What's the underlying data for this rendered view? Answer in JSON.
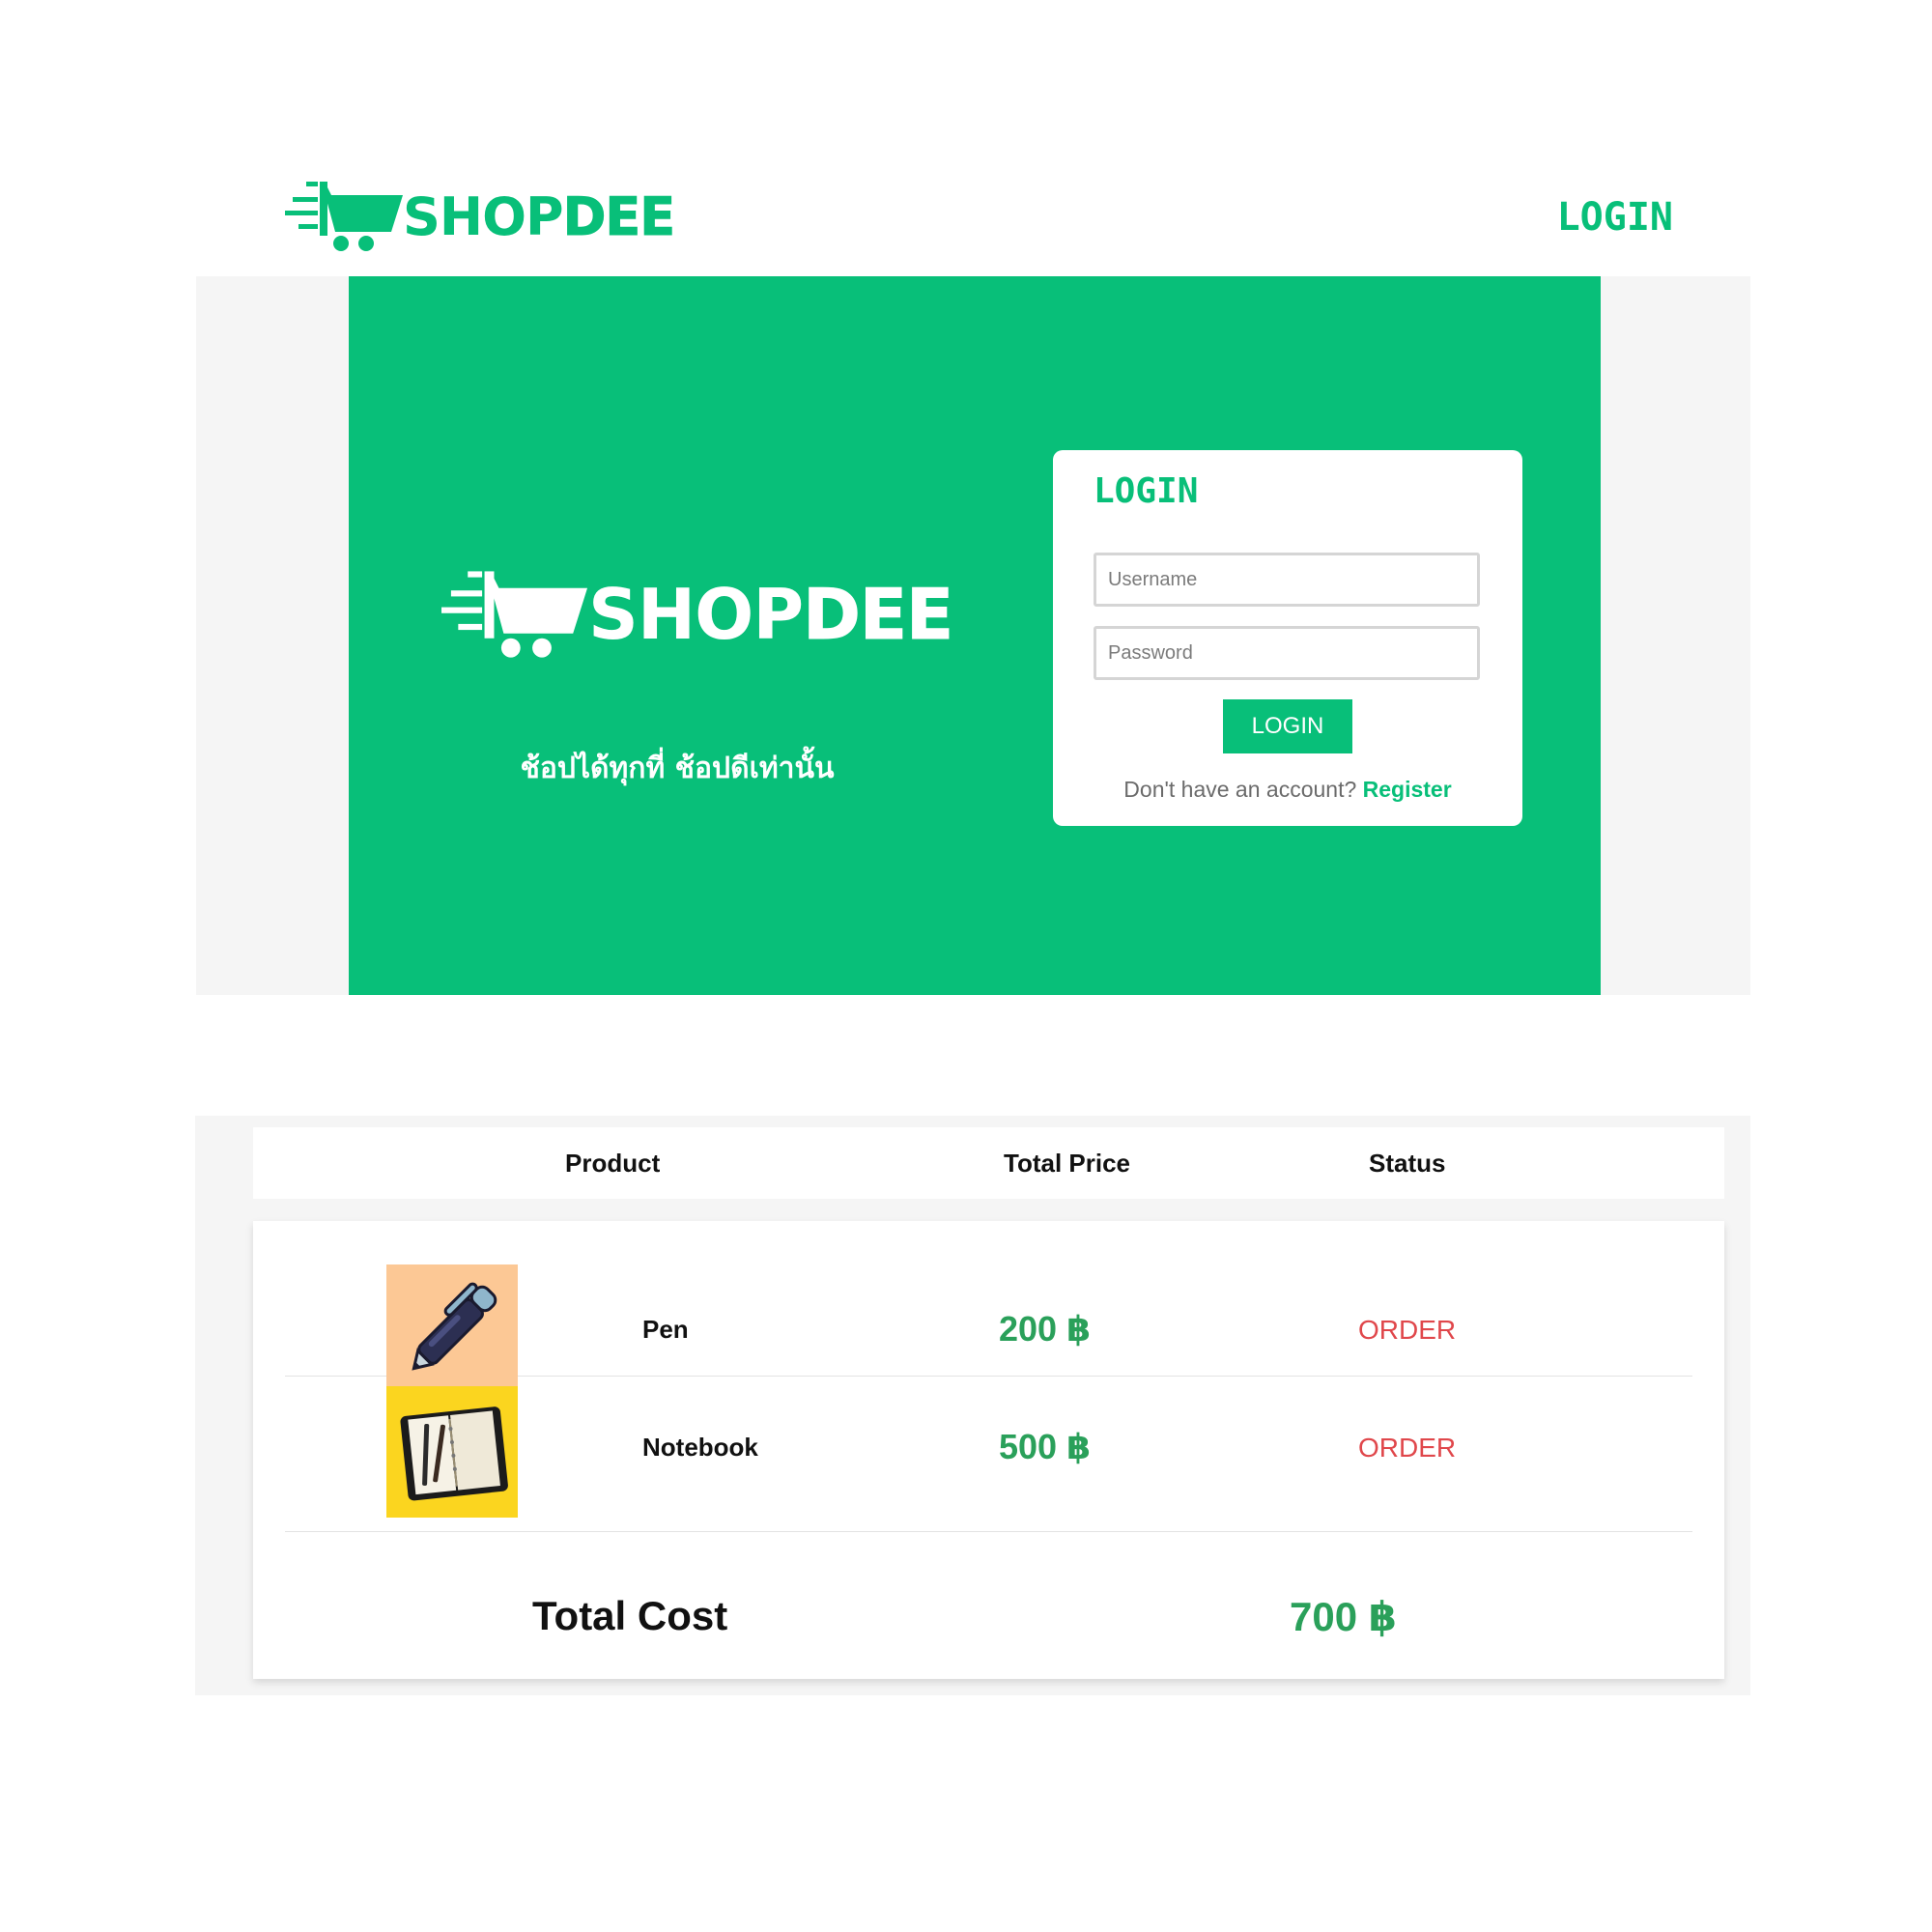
{
  "brand": {
    "primary": "#08bf79",
    "price_green": "#2aa05a",
    "status_red": "#e0474b",
    "logo_left": "SHOP",
    "logo_right": "DEE"
  },
  "nav": {
    "login_label": "LOGIN",
    "logo_icon": "shopping-cart-icon"
  },
  "hero": {
    "tagline": "ช้อปได้ทุกที่ ช้อปดีเท่านั้น"
  },
  "login_card": {
    "title": "LOGIN",
    "username_placeholder": "Username",
    "password_placeholder": "Password",
    "submit_label": "LOGIN",
    "no_account_text": "Don't have an account?",
    "register_label": "Register"
  },
  "orders": {
    "columns": [
      "Product",
      "Total Price",
      "Status"
    ],
    "rows": [
      {
        "name": "Pen",
        "price": "200 ฿",
        "status": "ORDER",
        "thumb_icon": "pen-icon"
      },
      {
        "name": "Notebook",
        "price": "500 ฿",
        "status": "ORDER",
        "thumb_icon": "notebook-icon"
      }
    ],
    "total_label": "Total Cost",
    "total_value": "700 ฿"
  }
}
